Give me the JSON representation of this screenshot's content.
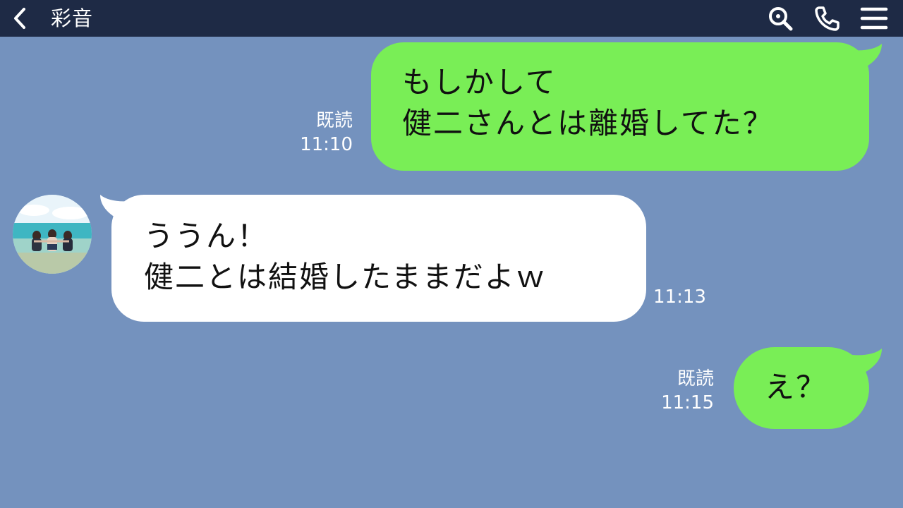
{
  "header": {
    "title": "彩音",
    "back_icon": "chevron-left-icon",
    "search_icon": "search-icon",
    "call_icon": "phone-icon",
    "menu_icon": "hamburger-menu-icon"
  },
  "colors": {
    "background": "#7492be",
    "header": "#1e2a45",
    "outgoing_bubble": "#79ee56",
    "incoming_bubble": "#ffffff"
  },
  "messages": [
    {
      "direction": "outgoing",
      "text": "もしかして\n健二さんとは離婚してた？",
      "read_label": "既読",
      "time": "11:10"
    },
    {
      "direction": "incoming",
      "text": "ううん！\n健二とは結婚したままだよｗ",
      "time": "11:13"
    },
    {
      "direction": "outgoing",
      "text": "え？",
      "read_label": "既読",
      "time": "11:15"
    }
  ]
}
